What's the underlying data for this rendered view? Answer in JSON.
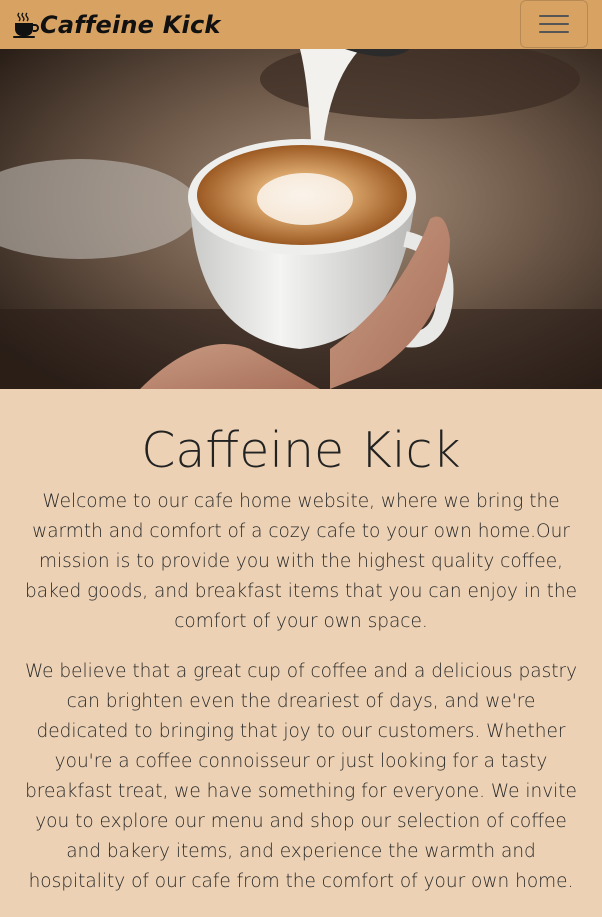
{
  "navbar": {
    "brand_text": "Caffeine Kick",
    "brand_icon": "coffee-cup-icon",
    "menu_icon": "hamburger-menu-icon",
    "background": "#d8a263"
  },
  "hero": {
    "image_description": "latte art being poured into a white coffee cup"
  },
  "main": {
    "title": "Caffeine Kick",
    "paragraphs": [
      "Welcome to our cafe home website, where we bring the warmth and comfort of a cozy cafe to your own home.Our mission is to provide you with the highest quality coffee, baked goods, and breakfast items that you can enjoy in the comfort of your own space.",
      "We believe that a great cup of coffee and a delicious pastry can brighten even the dreariest of days, and we're dedicated to bringing that joy to our customers. Whether you're a coffee connoisseur or just looking for a tasty breakfast treat, we have something for everyone. We invite you to explore our menu and shop our selection of coffee and bakery items, and experience the warmth and hospitality of our cafe from the comfort of your own home."
    ],
    "background": "#ecd1b4"
  }
}
